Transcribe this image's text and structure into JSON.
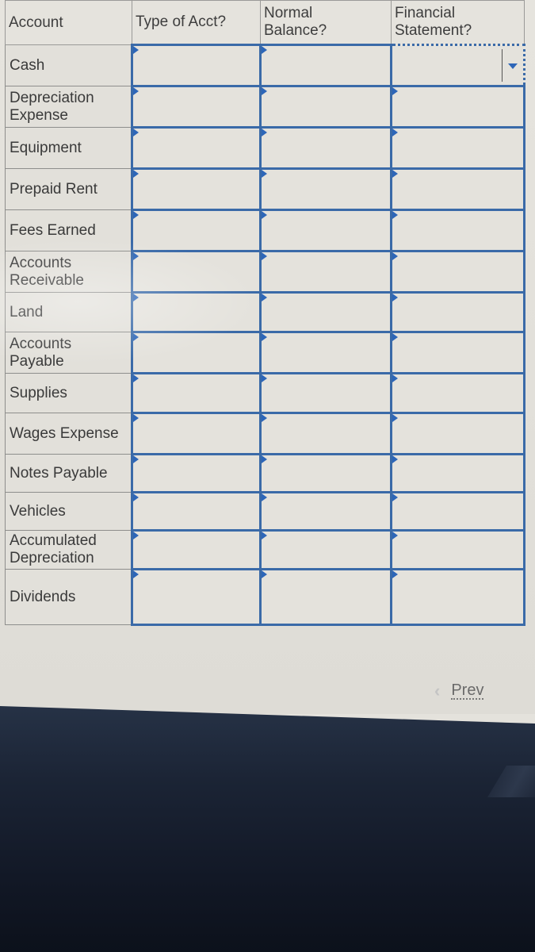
{
  "table": {
    "headers": {
      "account": "Account",
      "type": "Type of Acct?",
      "normal_balance_line1": "Normal",
      "normal_balance_line2": "Balance?",
      "financial_statement_line1": "Financial",
      "financial_statement_line2": "Statement?"
    },
    "rows": [
      {
        "account": "Cash"
      },
      {
        "account": "Depreciation Expense"
      },
      {
        "account": "Equipment"
      },
      {
        "account": "Prepaid Rent"
      },
      {
        "account": "Fees Earned"
      },
      {
        "account": "Accounts Receivable"
      },
      {
        "account": "Land"
      },
      {
        "account": "Accounts Payable"
      },
      {
        "account": "Supplies"
      },
      {
        "account": "Wages Expense"
      },
      {
        "account": "Notes Payable"
      },
      {
        "account": "Vehicles"
      },
      {
        "account": "Accumulated Depreciation"
      },
      {
        "account": "Dividends"
      }
    ],
    "dropdown_values": {
      "type": "",
      "normal_balance": "",
      "financial_statement": ""
    },
    "focused_cell": "Cash / Financial Statement?"
  },
  "navigation": {
    "prev_label": "Prev",
    "prev_icon": "chevron-left-icon"
  },
  "colors": {
    "cell_border": "#3a6aa8",
    "marker": "#2d66b8",
    "text": "#3a3a3a",
    "background": "#e4e2dc"
  }
}
